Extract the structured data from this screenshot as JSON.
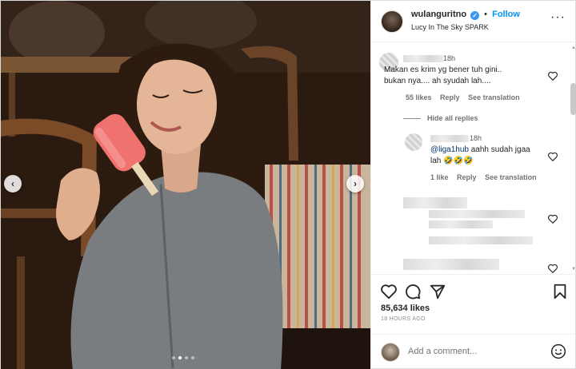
{
  "post": {
    "username": "wulanguritno",
    "separator": "•",
    "follow_label": "Follow",
    "audio": "Lucy In The Sky SPARK",
    "more_label": "···",
    "verified_mark": "✓"
  },
  "carousel": {
    "prev": "‹",
    "next": "›",
    "slide_count": 4,
    "active_slide": 2
  },
  "comments": [
    {
      "time": "18h",
      "lines": [
        "Makan es krim yg bener tuh gini..",
        "bukan nya.... ah syudah lah...."
      ],
      "likes": "55 likes",
      "reply": "Reply",
      "translate": "See translation"
    }
  ],
  "hide_replies": "Hide all replies",
  "reply": {
    "time": "18h",
    "mention": "@liga1hub",
    "text": " aahh sudah jgaa",
    "line2": "lah 🤣🤣🤣",
    "likes": "1 like",
    "reply": "Reply",
    "translate": "See translation"
  },
  "footer": {
    "likes": "85,634 likes",
    "ago": "18 HOURS AGO",
    "add_comment_placeholder": "Add a comment..."
  },
  "colors": {
    "accent": "#0095f6",
    "verified": "#3897f0"
  }
}
